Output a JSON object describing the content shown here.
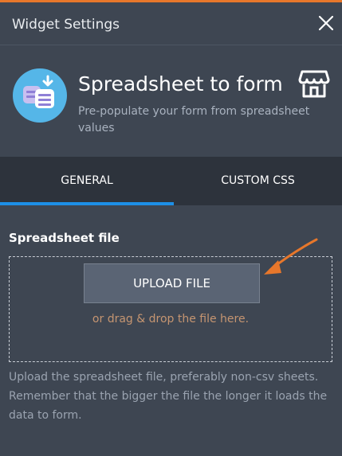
{
  "header": {
    "title": "Widget Settings",
    "close_icon": "close-icon"
  },
  "app": {
    "title": "Spreadsheet to form",
    "description": "Pre-populate your form from spreadsheet values",
    "icon": "spreadsheet-form-icon",
    "store_icon": "store-icon"
  },
  "tabs": [
    {
      "label": "GENERAL",
      "active": true
    },
    {
      "label": "CUSTOM CSS",
      "active": false
    }
  ],
  "field": {
    "label": "Spreadsheet file",
    "upload_button": "UPLOAD FILE",
    "drop_hint": "or drag & drop the file here.",
    "help": "Upload the spreadsheet file, preferably non-csv sheets. Remember that the bigger the file the longer it loads the data to form."
  },
  "colors": {
    "background": "#3e4652",
    "tab_bar": "#2d333c",
    "active_tab_indicator": "#1d8fe6",
    "accent_orange": "#e7772b",
    "icon_circle": "#55b6e8"
  }
}
